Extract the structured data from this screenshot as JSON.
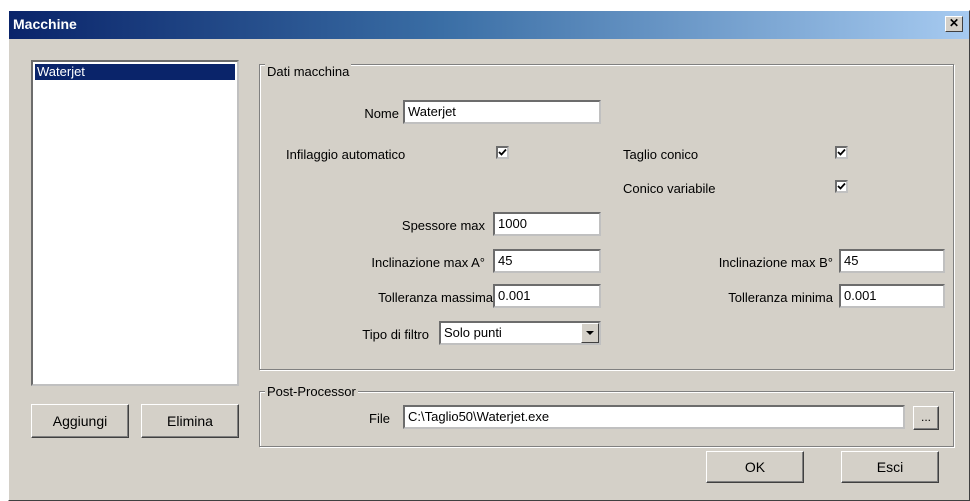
{
  "window": {
    "title": "Macchine"
  },
  "machines_list": {
    "items": [
      "Waterjet"
    ]
  },
  "buttons": {
    "add": "Aggiungi",
    "delete": "Elimina",
    "ok": "OK",
    "exit": "Esci",
    "browse": "..."
  },
  "machine_data": {
    "group_label": "Dati macchina",
    "name_label": "Nome",
    "name_value": "Waterjet",
    "auto_threading_label": "Infilaggio automatico",
    "auto_threading_checked": true,
    "conical_cut_label": "Taglio conico",
    "conical_cut_checked": true,
    "variable_conical_label": "Conico variabile",
    "variable_conical_checked": true,
    "max_thickness_label": "Spessore max",
    "max_thickness_value": "1000",
    "max_incl_a_label": "Inclinazione max A°",
    "max_incl_a_value": "45",
    "max_incl_b_label": "Inclinazione max B°",
    "max_incl_b_value": "45",
    "max_tol_label": "Tolleranza massima",
    "max_tol_value": "0.001",
    "min_tol_label": "Tolleranza minima",
    "min_tol_value": "0.001",
    "filter_type_label": "Tipo di filtro",
    "filter_type_value": "Solo punti"
  },
  "post_processor": {
    "group_label": "Post-Processor",
    "file_label": "File",
    "file_value": "C:\\Taglio50\\Waterjet.exe"
  }
}
